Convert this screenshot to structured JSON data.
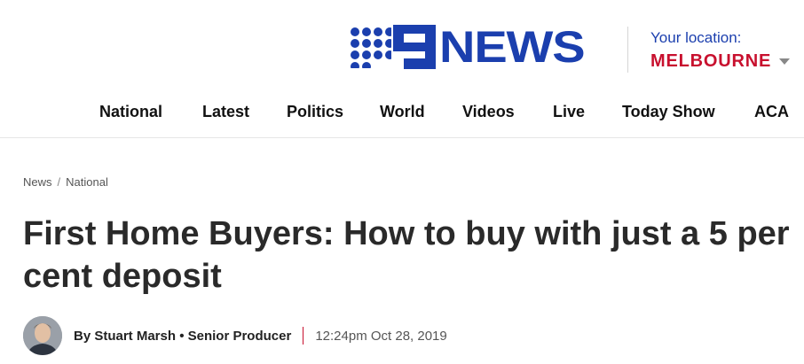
{
  "brand": {
    "name": "9NEWS",
    "logo_text": "NEWS",
    "logo_color": "#1b3fae"
  },
  "location": {
    "label": "Your location:",
    "value": "MELBOURNE",
    "value_color": "#c8102e"
  },
  "nav": {
    "items": [
      {
        "label": "National"
      },
      {
        "label": "Latest"
      },
      {
        "label": "Politics"
      },
      {
        "label": "World"
      },
      {
        "label": "Videos"
      },
      {
        "label": "Live"
      },
      {
        "label": "Today Show"
      },
      {
        "label": "ACA"
      }
    ]
  },
  "breadcrumb": {
    "items": [
      {
        "label": "News"
      },
      {
        "label": "National"
      }
    ],
    "separator": "/"
  },
  "article": {
    "title": "First Home Buyers: How to buy with just a 5 per cent deposit",
    "author": "By Stuart Marsh • Senior Producer",
    "timestamp": "12:24pm Oct 28, 2019"
  },
  "icons": {
    "logo": "nine-dots-logo-icon",
    "dropdown": "chevron-down-icon",
    "avatar": "author-avatar"
  }
}
